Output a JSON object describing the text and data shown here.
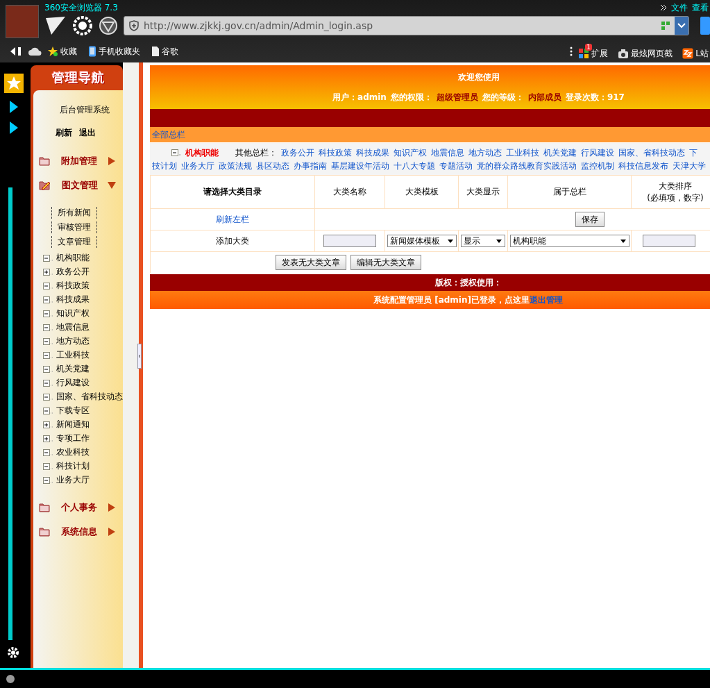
{
  "browser": {
    "title": "360安全浏览器 7.3",
    "menu": [
      "文件",
      "查看"
    ],
    "address": "http://www.zjkkj.gov.cn/admin/Admin_login.asp",
    "bookmarks": [
      {
        "label": "收藏",
        "kind": "star"
      },
      {
        "label": "手机收藏夹",
        "kind": "phone"
      },
      {
        "label": "谷歌",
        "kind": "page"
      }
    ],
    "tools": [
      {
        "label": "扩展",
        "badge": "1",
        "kind": "apps"
      },
      {
        "label": "最炫网页截",
        "kind": "camera"
      },
      {
        "label": "L站",
        "kind": "zz"
      }
    ]
  },
  "sidebar": {
    "title": "管理导航",
    "system_name": "后台管理系统",
    "actions": [
      "刷新",
      "退出"
    ],
    "sections": [
      {
        "label": "附加管理",
        "expanded": false,
        "kind": "folder"
      },
      {
        "label": "图文管理",
        "expanded": true,
        "kind": "edit",
        "links": [
          "所有新闻",
          "审核管理",
          "文章管理"
        ],
        "tree": [
          {
            "label": "机构职能",
            "expanded": true
          },
          {
            "label": "政务公开",
            "expanded": false
          },
          {
            "label": "科技政策",
            "expanded": true
          },
          {
            "label": "科技成果",
            "expanded": true
          },
          {
            "label": "知识产权",
            "expanded": true
          },
          {
            "label": "地震信息",
            "expanded": true
          },
          {
            "label": "地方动态",
            "expanded": true
          },
          {
            "label": "工业科技",
            "expanded": true
          },
          {
            "label": "机关党建",
            "expanded": true
          },
          {
            "label": "行风建设",
            "expanded": true
          },
          {
            "label": "国家、省科技动态",
            "expanded": true
          },
          {
            "label": "下载专区",
            "expanded": true
          },
          {
            "label": "新闻通知",
            "expanded": false
          },
          {
            "label": "专项工作",
            "expanded": false
          },
          {
            "label": "农业科技",
            "expanded": true
          },
          {
            "label": "科技计划",
            "expanded": true
          },
          {
            "label": "业务大厅",
            "expanded": true
          }
        ]
      },
      {
        "label": "个人事务",
        "expanded": false,
        "kind": "folder"
      },
      {
        "label": "系统信息",
        "expanded": false,
        "kind": "folder"
      }
    ]
  },
  "header": {
    "title": "欢迎您使用",
    "user_info": [
      {
        "text": "用户：admin",
        "kind": "label"
      },
      {
        "text": "您的权限：",
        "kind": "label"
      },
      {
        "text": "超级管理员",
        "kind": "value"
      },
      {
        "text": "您的等级：",
        "kind": "label"
      },
      {
        "text": "内部成员",
        "kind": "value"
      },
      {
        "text": "登录次数：917",
        "kind": "label"
      }
    ]
  },
  "all_columns": "全部总栏",
  "category": {
    "current": "机构职能",
    "others_label": "其他总栏：",
    "lines": [
      [
        "政务公开",
        "科技政策",
        "科技成果",
        "知识产权",
        "地震信息",
        "地方动态",
        "工业科技",
        "机关党建",
        "行风建设",
        "国家、省科技动态",
        "下"
      ],
      [
        "技计划",
        "业务大厅",
        "政策法规",
        "县区动态",
        "办事指南",
        "基层建设年活动",
        "十八大专题",
        "专题活动",
        "党的群众路线教育实践活动",
        "监控机制",
        "科技信息发布",
        "天津大学"
      ]
    ]
  },
  "table": {
    "columns": [
      "请选择大类目录",
      "大类名称",
      "大类模板",
      "大类显示",
      "属于总栏",
      "大类排序\n(必填项，数字)"
    ],
    "refresh_link": "刷新左栏",
    "save_button": "保存",
    "add_label": "添加大类",
    "template_select": "新闻媒体模板",
    "display_select": "显示",
    "column_select": "机构职能",
    "buttons": [
      "发表无大类文章",
      "编辑无大类文章"
    ]
  },
  "copyright": "版权：授权使用：",
  "footer": {
    "text": "系统配置管理员 [admin]已登录，点这里",
    "link": "退出管理"
  }
}
